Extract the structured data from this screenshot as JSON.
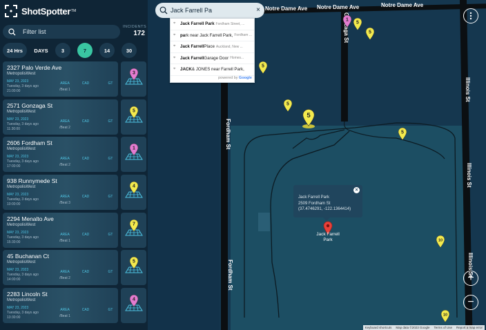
{
  "brand": {
    "name": "ShotSpotter",
    "trademark": "TM"
  },
  "sidebar": {
    "filter_placeholder": "Filter list",
    "incidents_label": "INCIDENTS",
    "incidents_count": "172",
    "ranges": [
      {
        "label": "24 Hrs",
        "active": false
      },
      {
        "label": "DAYS",
        "active": false
      },
      {
        "label": "3",
        "active": false
      },
      {
        "label": "7",
        "active": true
      },
      {
        "label": "14",
        "active": false
      },
      {
        "label": "30",
        "active": false
      }
    ],
    "tag_labels": {
      "area": "AREA",
      "cad": "CAD",
      "gt": "GT"
    },
    "incidents": [
      {
        "address": "2327 Palo Verde Ave",
        "city": "MetropolisWest",
        "date": "MAY 23, 2023",
        "day": "Tuesday, 3 days ago",
        "time": "21:00:00",
        "beat": "/Beat 1",
        "count": "3",
        "pin_color": "#e37bd0"
      },
      {
        "address": "2571 Gonzaga St",
        "city": "MetropolisWest",
        "date": "MAY 23, 2023",
        "day": "Tuesday, 3 days ago",
        "time": "11:30:00",
        "beat": "/Beat 2",
        "count": "5",
        "pin_color": "#f3ea4d"
      },
      {
        "address": "2606 Fordham St",
        "city": "MetropolisWest",
        "date": "MAY 23, 2023",
        "day": "Tuesday, 3 days ago",
        "time": "17:00:00",
        "beat": "/Beat 2",
        "count": "1",
        "pin_color": "#e37bd0"
      },
      {
        "address": "938 Runnymede St",
        "city": "MetropolisWest",
        "date": "MAY 23, 2023",
        "day": "Tuesday, 3 days ago",
        "time": "10:00:00",
        "beat": "/Beat 3",
        "count": "4",
        "pin_color": "#f3ea4d"
      },
      {
        "address": "2294 Menalto Ave",
        "city": "MetropolisWest",
        "date": "MAY 23, 2023",
        "day": "Tuesday, 3 days ago",
        "time": "15:30:00",
        "beat": "/Beat 1",
        "count": "7",
        "pin_color": "#f3ea4d"
      },
      {
        "address": "45 Buchanan Ct",
        "city": "MetropolisWest",
        "date": "MAY 23, 2023",
        "day": "Tuesday, 3 days ago",
        "time": "14:00:00",
        "beat": "/Beat 2",
        "count": "5",
        "pin_color": "#f3ea4d"
      },
      {
        "address": "2283 Lincoln St",
        "city": "MetropolisWest",
        "date": "MAY 23, 2023",
        "day": "Tuesday, 3 days ago",
        "time": "13:30:00",
        "beat": "/Beat 1",
        "count": "4",
        "pin_color": "#e37bd0"
      }
    ]
  },
  "search": {
    "value": "Jack Farrell Pa",
    "suggestions": [
      {
        "bold": "Jack Farrell Park",
        "rest": "",
        "sub": "Fordham Street, ..."
      },
      {
        "bold": "pa",
        "rest": "rk near Jack Farrell Park,",
        "sub": "Fordham ..."
      },
      {
        "bold": "Jack Farrell",
        "rest": " Place",
        "sub": "Auckland, New ..."
      },
      {
        "bold": "Jack Farrell",
        "rest": " Garage Door",
        "sub": "Homes..."
      },
      {
        "bold": "JACK",
        "rest": " & JONES near Farrell Park,",
        "sub": ""
      }
    ],
    "powered_by": "powered by",
    "google": "Google"
  },
  "map": {
    "streets": {
      "notre_dame_1": "Notre Dame Ave",
      "notre_dame_2": "Notre Dame Ave",
      "notre_dame_3": "Notre Dame Ave",
      "gonzaga": "Gonzaga St",
      "fordham_1": "Fordham St",
      "fordham_2": "Fordham St",
      "illinois_1": "Illinois St",
      "illinois_2": "Illinois St",
      "illinois_3": "Illinois St"
    },
    "popup": {
      "line1": "Jack Farrell Park",
      "line2": "2509 Fordham St",
      "line3": "(37.4746291, -122.1364414)"
    },
    "park_label_line1": "Jack Farrell",
    "park_label_line2": "Park",
    "pins": [
      {
        "label": "1",
        "color": "#e37bd0"
      },
      {
        "label": "5",
        "color": "#f3ea4d"
      },
      {
        "label": "5",
        "color": "#f3ea4d"
      },
      {
        "label": "5",
        "color": "#f3ea4d"
      },
      {
        "label": "5",
        "color": "#f3ea4d"
      },
      {
        "label": "5",
        "color": "#f3ea4d"
      },
      {
        "label": "5",
        "color": "#f3ea4d"
      },
      {
        "label": "10",
        "color": "#f3ea4d"
      },
      {
        "label": "10",
        "color": "#f3ea4d"
      }
    ],
    "attribution": [
      "Keyboard shortcuts",
      "Map data ©2023 Google",
      "Terms of Use",
      "Report a map error"
    ]
  },
  "colors": {
    "accent": "#39c6a2",
    "link": "#4fc4e3",
    "panel": "#0f2536"
  }
}
